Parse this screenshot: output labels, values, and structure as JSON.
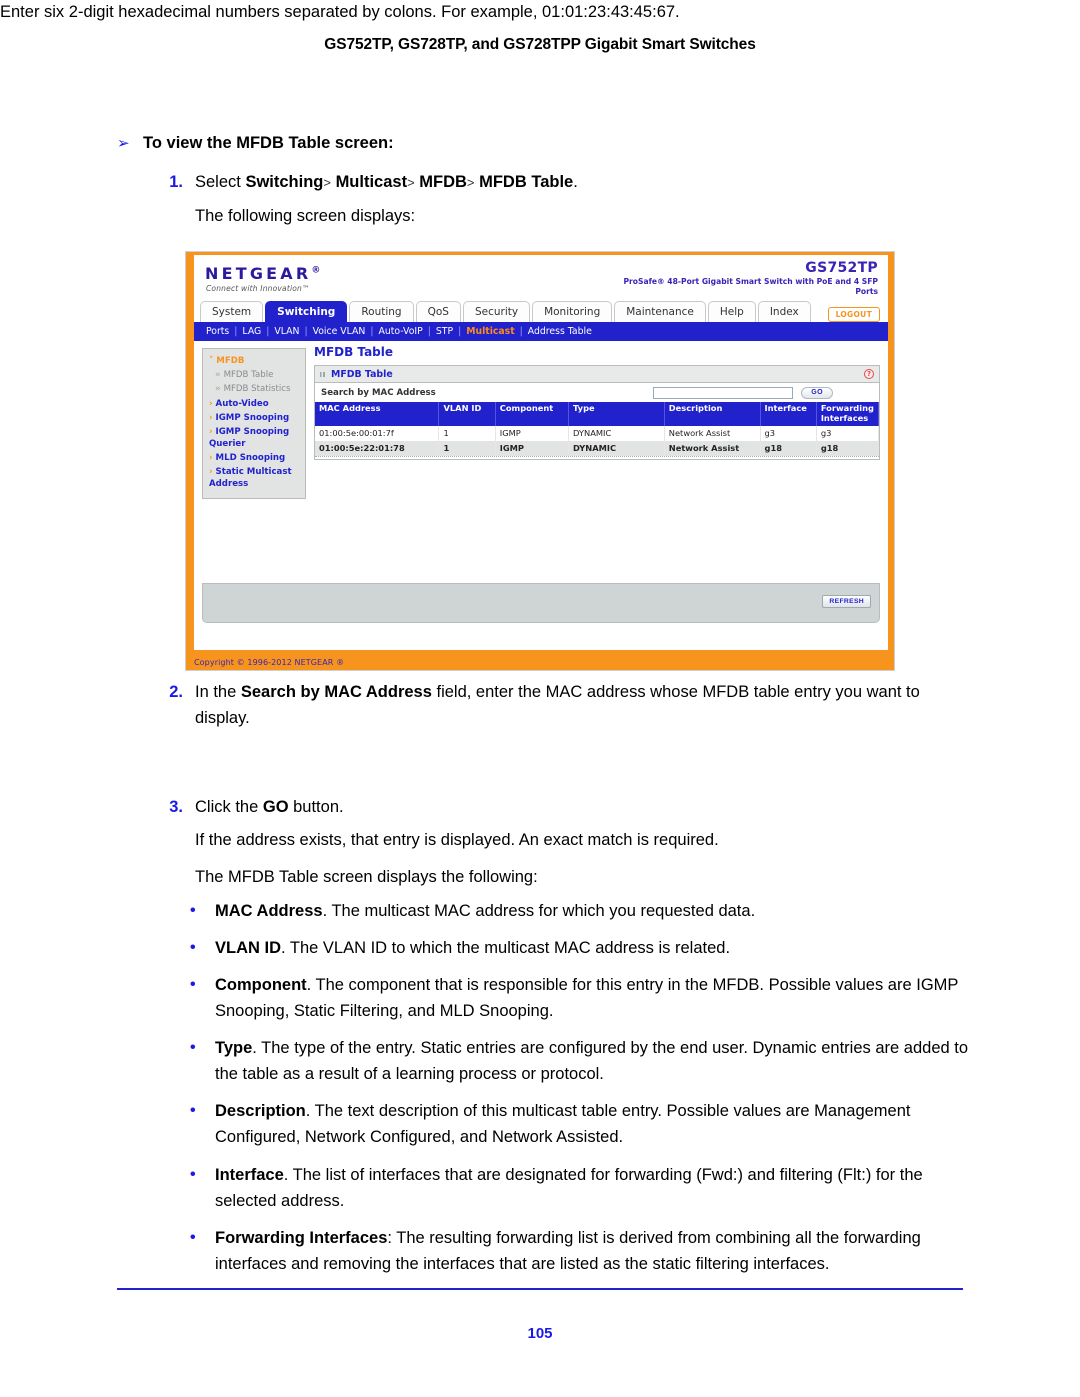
{
  "running_head": "GS752TP, GS728TP, and GS728TPP Gigabit Smart Switches",
  "procedure": {
    "marker": "➢",
    "heading": "To view the MFDB Table screen:"
  },
  "steps": {
    "one_num": "1.",
    "one_select": "Select",
    "one_path": [
      "Switching",
      "Multicast",
      "MFDB",
      "MFDB Table"
    ],
    "one_separator": ">",
    "one_period": ".",
    "one_sub": "The following screen displays:",
    "two_num": "2.",
    "two_pre": "In the ",
    "two_bold": "Search by MAC Address",
    "two_post": " field, enter the MAC address whose MFDB table entry you want to display.",
    "two_p2": "Enter six 2-digit hexadecimal numbers separated by colons. For example, 01:01:23:43:45:67.",
    "three_num": "3.",
    "three_pre": "Click the ",
    "three_bold": "GO",
    "three_post": " button.",
    "three_sub": "If the address exists, that entry is displayed. An exact match is required.",
    "list_intro": "The MFDB Table screen displays the following:"
  },
  "bullets": [
    {
      "marker": "•",
      "term": "MAC Address",
      "sep": ". ",
      "text": "The multicast MAC address for which you requested data."
    },
    {
      "marker": "•",
      "term": "VLAN ID",
      "sep": ". ",
      "text": "The VLAN ID to which the multicast MAC address is related."
    },
    {
      "marker": "•",
      "term": "Component",
      "sep": ". ",
      "text": "The component that is responsible for this entry in the MFDB. Possible values are IGMP Snooping, Static Filtering, and MLD Snooping."
    },
    {
      "marker": "•",
      "term": "Type",
      "sep": ". ",
      "text": "The type of the entry. Static entries are configured by the end user. Dynamic entries are added to the table as a result of a learning process or protocol."
    },
    {
      "marker": "•",
      "term": "Description",
      "sep": ". ",
      "text": "The text description of this multicast table entry. Possible values are Management Configured, Network Configured, and Network Assisted."
    },
    {
      "marker": "•",
      "term": "Interface",
      "sep": ". ",
      "text": "The list of interfaces that are designated for forwarding (Fwd:) and filtering (Flt:) for the selected address."
    },
    {
      "marker": "•",
      "term": "Forwarding Interfaces",
      "sep": ": ",
      "text": "The resulting forwarding list is derived from combining all the forwarding interfaces and removing the interfaces that are listed as the static filtering interfaces."
    }
  ],
  "folio": "105",
  "screenshot": {
    "brand": {
      "logo": "NETGEAR",
      "logo_mark": "®",
      "tagline": "Connect with Innovation™",
      "model": "GS752TP",
      "model_desc": "ProSafe® 48-Port Gigabit Smart Switch with PoE and 4 SFP Ports"
    },
    "tabs": [
      {
        "label": "System",
        "active": false
      },
      {
        "label": "Switching",
        "active": true
      },
      {
        "label": "Routing",
        "active": false
      },
      {
        "label": "QoS",
        "active": false
      },
      {
        "label": "Security",
        "active": false
      },
      {
        "label": "Monitoring",
        "active": false
      },
      {
        "label": "Maintenance",
        "active": false
      },
      {
        "label": "Help",
        "active": false
      },
      {
        "label": "Index",
        "active": false
      }
    ],
    "logout_label": "LOGOUT",
    "subnav": [
      {
        "label": "Ports",
        "current": false
      },
      {
        "label": "LAG",
        "current": false
      },
      {
        "label": "VLAN",
        "current": false
      },
      {
        "label": "Voice VLAN",
        "current": false
      },
      {
        "label": "Auto-VoIP",
        "current": false
      },
      {
        "label": "STP",
        "current": false
      },
      {
        "label": "Multicast",
        "current": true
      },
      {
        "label": "Address Table",
        "current": false
      }
    ],
    "subnav_sep": "|",
    "sidebar": [
      {
        "marker": "˅",
        "label": "MFDB",
        "style": "top"
      },
      {
        "marker": "»",
        "label": "MFDB Table",
        "style": "sub"
      },
      {
        "marker": "»",
        "label": "MFDB Statistics",
        "style": "sub"
      },
      {
        "marker": "›",
        "label": "Auto-Video",
        "style": "main"
      },
      {
        "marker": "›",
        "label": "IGMP Snooping",
        "style": "main"
      },
      {
        "marker": "›",
        "label": "IGMP Snooping Querier",
        "style": "main"
      },
      {
        "marker": "›",
        "label": "MLD Snooping",
        "style": "main"
      },
      {
        "marker": "›",
        "label": "Static Multicast Address",
        "style": "main"
      }
    ],
    "panel": {
      "page_title": "MFDB Table",
      "header_title": "MFDB Table",
      "help_icon": "?",
      "search_label": "Search by MAC Address",
      "search_value": "",
      "search_placeholder": "",
      "go_label": "GO"
    },
    "table": {
      "columns": [
        "MAC Address",
        "VLAN ID",
        "Component",
        "Type",
        "Description",
        "Interface",
        "Forwarding Interfaces"
      ],
      "rows": [
        [
          "01:00:5e:00:01:7f",
          "1",
          "IGMP",
          "DYNAMIC",
          "Network Assist",
          "g3",
          "g3"
        ],
        [
          "01:00:5e:22:01:78",
          "1",
          "IGMP",
          "DYNAMIC",
          "Network Assist",
          "g18",
          "g18"
        ]
      ]
    },
    "refresh_label": "REFRESH",
    "copyright": "Copyright © 1996-2012 NETGEAR ®"
  }
}
